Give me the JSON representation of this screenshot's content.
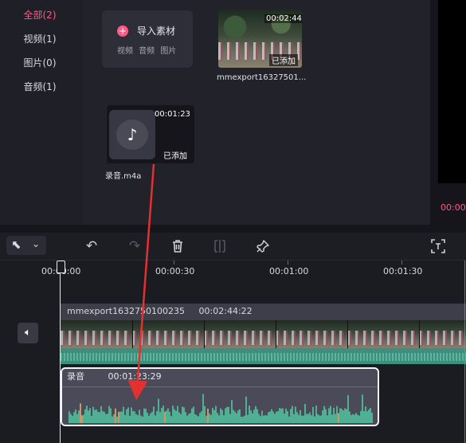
{
  "sidebar": {
    "items": [
      {
        "label": "全部(2)",
        "active": true
      },
      {
        "label": "视频(1)",
        "active": false
      },
      {
        "label": "图片(0)",
        "active": false
      },
      {
        "label": "音频(1)",
        "active": false
      }
    ]
  },
  "media": {
    "import": {
      "title": "导入素材",
      "types": "视频 音频 图片"
    },
    "video_item": {
      "duration": "00:02:44",
      "badge": "已添加",
      "name": "mmexport16327501..."
    },
    "audio_item": {
      "duration": "00:01:23",
      "badge": "已添加",
      "name": "录音.m4a"
    }
  },
  "preview": {
    "timecode": "00:00"
  },
  "toolbar": {
    "tools": [
      "select-tool",
      "undo-icon",
      "redo-icon",
      "delete-icon",
      "split-icon",
      "pin-icon",
      "fit-icon"
    ]
  },
  "timeline": {
    "ruler_labels": [
      "00:00:00",
      "00:00:30",
      "00:01:00",
      "00:01:30"
    ],
    "video_track": {
      "name": "mmexport1632750100235",
      "duration": "00:02:44:22"
    },
    "audio_track": {
      "name": "录音",
      "duration": "00:01:23:29"
    }
  },
  "colors": {
    "accent": "#ff5a85",
    "waveform": "#3d8f7d",
    "annotation_arrow": "#e53030"
  }
}
